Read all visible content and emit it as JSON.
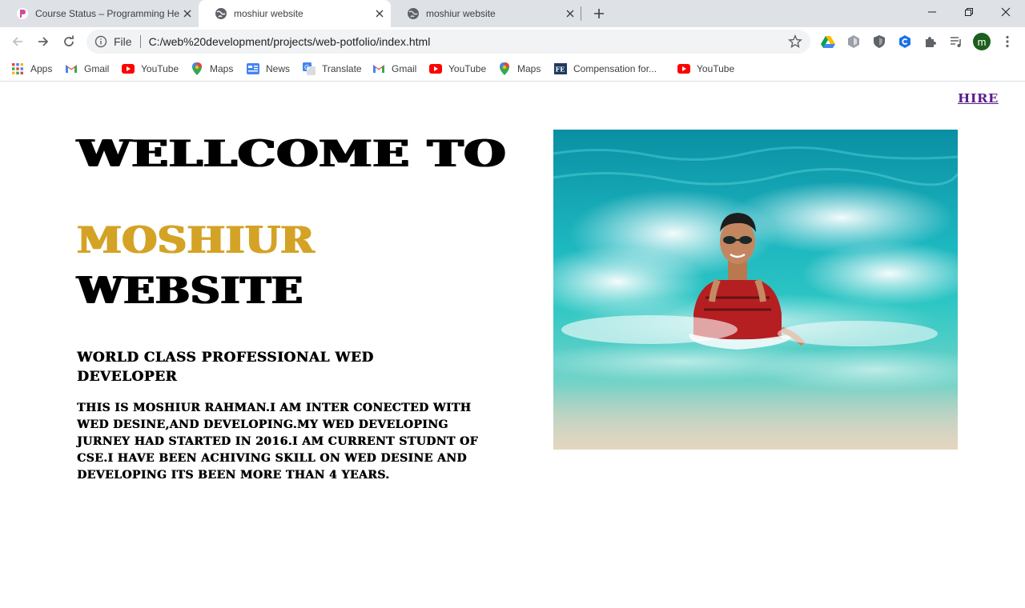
{
  "browser": {
    "tabs": [
      {
        "title": "Course Status – Programming He",
        "active": false,
        "icon": "programming-hero-icon"
      },
      {
        "title": "moshiur website",
        "active": true,
        "icon": "globe-icon"
      },
      {
        "title": "moshiur website",
        "active": false,
        "icon": "globe-icon"
      }
    ],
    "new_tab": "+",
    "address": {
      "scheme_label": "File",
      "url": "C:/web%20development/projects/web-potfolio/index.html"
    },
    "profile_initial": "m",
    "bookmarks": [
      {
        "label": "Apps",
        "icon": "apps-grid-icon"
      },
      {
        "label": "Gmail",
        "icon": "gmail-icon"
      },
      {
        "label": "YouTube",
        "icon": "youtube-icon"
      },
      {
        "label": "Maps",
        "icon": "maps-pin-icon"
      },
      {
        "label": "News",
        "icon": "news-icon"
      },
      {
        "label": "Translate",
        "icon": "translate-icon"
      },
      {
        "label": "Gmail",
        "icon": "gmail-icon"
      },
      {
        "label": "YouTube",
        "icon": "youtube-icon"
      },
      {
        "label": "Maps",
        "icon": "maps-pin-icon"
      },
      {
        "label": "Compensation for...",
        "icon": "fe-icon"
      },
      {
        "label": "YouTube",
        "icon": "youtube-icon"
      }
    ]
  },
  "page": {
    "nav_link": "HIRE",
    "heading_line1": "WELLCOME TO",
    "heading_name": "MOSHIUR",
    "heading_line3": "WEBSITE",
    "subtitle": "WORLD CLASS PROFESSIONAL WED DEVELOPER",
    "about": "THIS IS MOSHIUR RAHMAN.I AM INTER CONECTED WITH WED DESINE,AND DEVELOPING.MY WED DEVELOPING JURNEY HAD STARTED IN 2016.I AM CURRENT STUDNT OF CSE.I HAVE BEEN ACHIVING SKILL ON WED DESINE AND DEVELOPING ITS BEEN MORE THAN 4 YEARS.",
    "photo": "man-in-ocean-waves-photo"
  },
  "colors": {
    "name_accent": "#d4a326",
    "link": "#5b1d8f",
    "tabstrip": "#dee1e6"
  }
}
